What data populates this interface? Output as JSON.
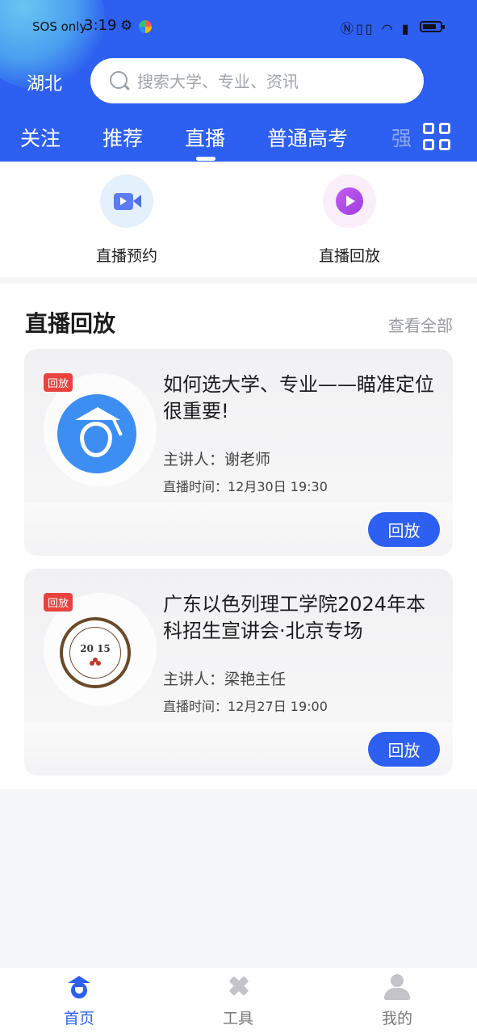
{
  "status_bar": {
    "carrier": "SOS only",
    "time": "3:19",
    "right_icons": "NFC vibrate wifi battery"
  },
  "header": {
    "region": "湖北",
    "search_placeholder": "搜索大学、专业、资讯",
    "tabs": [
      {
        "label": "关注",
        "active": false
      },
      {
        "label": "推荐",
        "active": false
      },
      {
        "label": "直播",
        "active": true
      },
      {
        "label": "普通高考",
        "active": false
      },
      {
        "label": "强",
        "active": false
      }
    ],
    "brand_color": "#2d5ff0"
  },
  "quick_entries": [
    {
      "label": "直播预约",
      "icon": "video-camera-icon"
    },
    {
      "label": "直播回放",
      "icon": "play-icon"
    }
  ],
  "replay_section": {
    "title": "直播回放",
    "see_all": "查看全部",
    "items": [
      {
        "badge": "回放",
        "title": "如何选大学、专业——瞄准定位很重要!",
        "speaker": "主讲人：谢老师",
        "time": "直播时间：12月30日 19:30",
        "button": "回放",
        "logo": "graduation-cap-logo"
      },
      {
        "badge": "回放",
        "title": "广东以色列理工学院2024年本科招生宣讲会·北京专场",
        "speaker": "主讲人：梁艳主任",
        "time": "直播时间：12月27日 19:00",
        "button": "回放",
        "logo": "guangdong-technion-seal",
        "logo_year": "20 15"
      }
    ]
  },
  "bottom_nav": [
    {
      "label": "首页",
      "active": true,
      "icon": "home-cap-icon"
    },
    {
      "label": "工具",
      "active": false,
      "icon": "tools-icon"
    },
    {
      "label": "我的",
      "active": false,
      "icon": "person-icon"
    }
  ]
}
